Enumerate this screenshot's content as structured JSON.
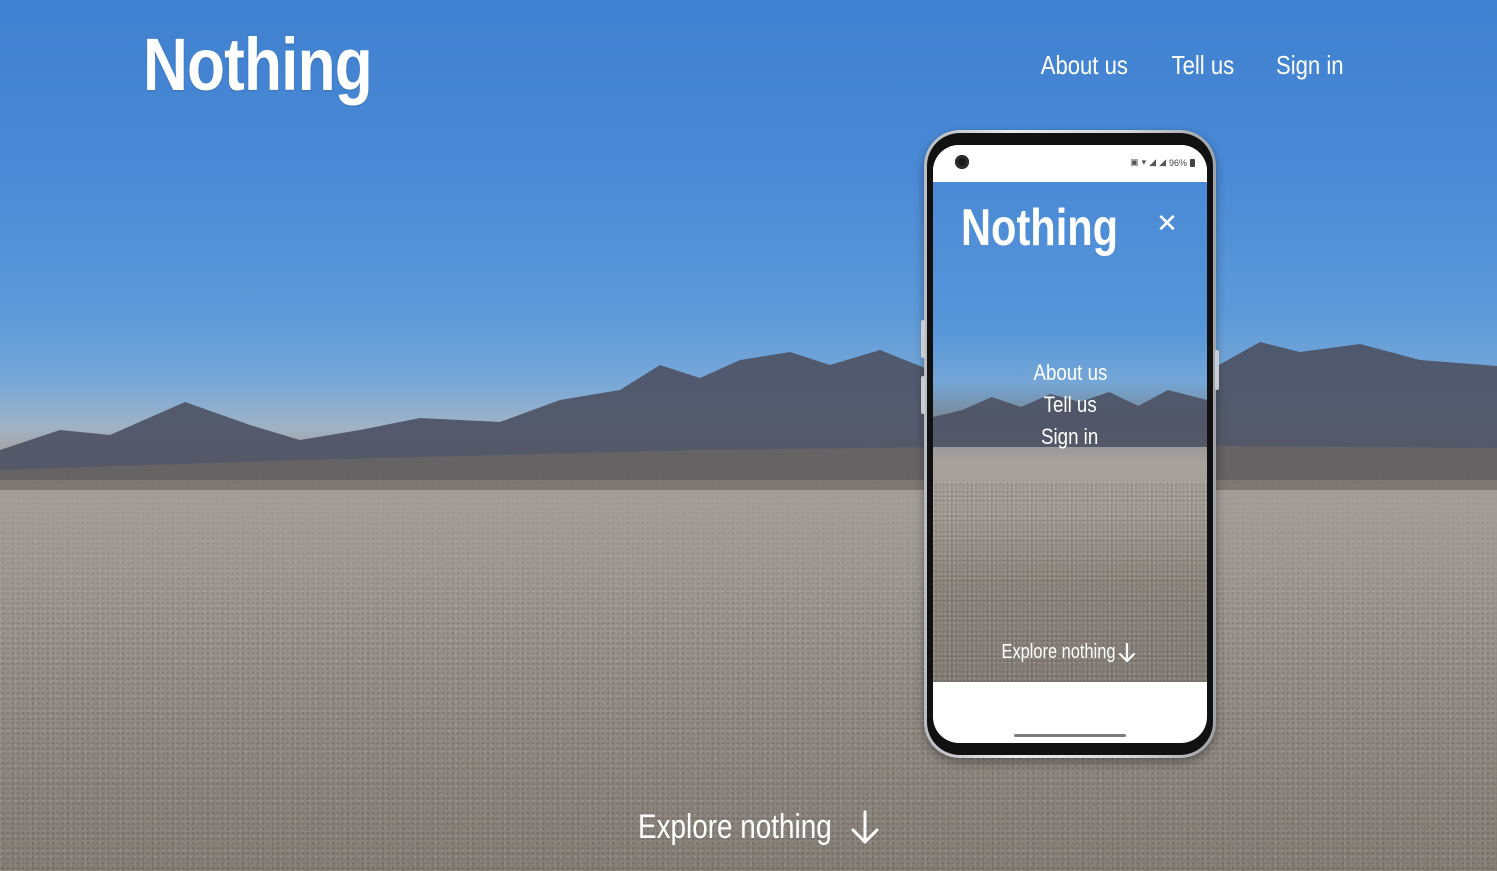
{
  "header": {
    "logo": "Nothing",
    "nav": [
      {
        "label": "About us"
      },
      {
        "label": "Tell us"
      },
      {
        "label": "Sign in"
      }
    ]
  },
  "hero": {
    "explore_label": "Explore nothing",
    "explore_icon": "arrow-down-icon"
  },
  "phone_mockup": {
    "status": {
      "battery": "96%",
      "icons": [
        "nfc-icon",
        "wifi-icon",
        "signal-icon",
        "signal-icon",
        "battery-icon"
      ]
    },
    "app": {
      "logo": "Nothing",
      "close_icon": "close-icon",
      "menu": [
        {
          "label": "About us"
        },
        {
          "label": "Tell us"
        },
        {
          "label": "Sign in"
        }
      ],
      "explore_label": "Explore nothing"
    }
  },
  "colors": {
    "sky": "#4a8ad6",
    "text": "#ffffff"
  }
}
